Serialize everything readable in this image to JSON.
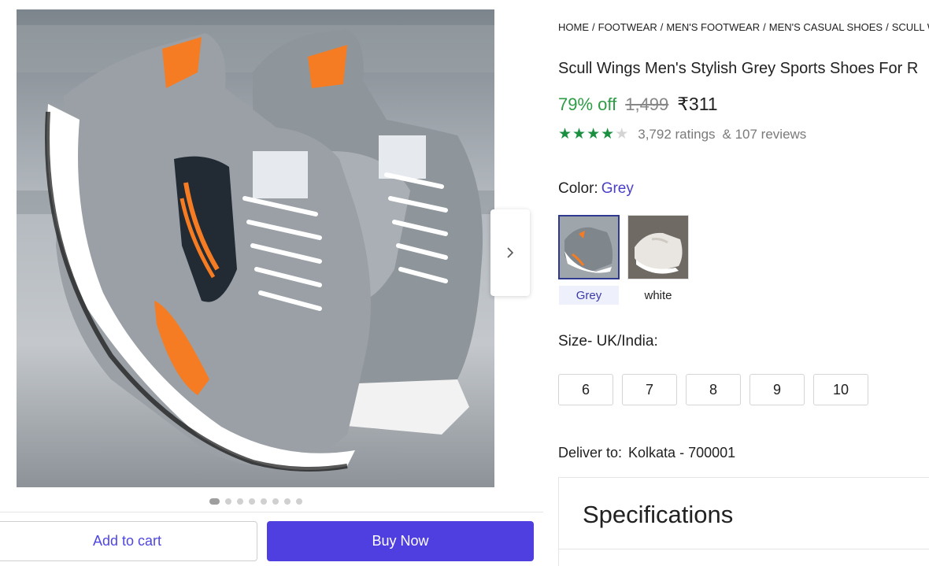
{
  "gallery": {
    "image_alt": "Grey sports shoes with orange accents",
    "dots_count": 8,
    "active_dot": 0,
    "next_icon": "chevron-right-icon"
  },
  "actions": {
    "add_to_cart": "Add to cart",
    "buy_now": "Buy Now"
  },
  "breadcrumb": [
    "HOME",
    "FOOTWEAR",
    "MEN'S FOOTWEAR",
    "MEN'S CASUAL SHOES",
    "SCULL WINGS"
  ],
  "product": {
    "title": "Scull Wings Men's Stylish Grey Sports Shoes For R",
    "discount": "79% off",
    "mrp": "1,499",
    "price": "₹311",
    "stars_filled": 4,
    "stars_total": 5,
    "ratings": "3,792 ratings",
    "reviews": "& 107 reviews"
  },
  "color": {
    "label": "Color:",
    "value": "Grey",
    "options": [
      {
        "name": "Grey",
        "selected": true
      },
      {
        "name": "white",
        "selected": false
      }
    ]
  },
  "size": {
    "label": "Size- UK/India:",
    "options": [
      "6",
      "7",
      "8",
      "9",
      "10"
    ]
  },
  "delivery": {
    "label": "Deliver to:",
    "location": "Kolkata - 700001"
  },
  "specifications": {
    "title": "Specifications"
  },
  "colors": {
    "accent": "#4f3ee0",
    "discount_green": "#2e9b46",
    "star_green": "#1a8f3f"
  }
}
